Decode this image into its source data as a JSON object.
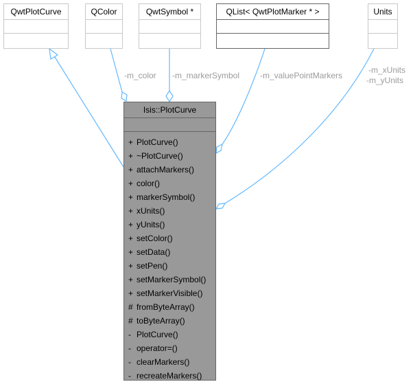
{
  "diagram": {
    "main_class": {
      "name": "Isis::PlotCurve",
      "methods": [
        {
          "vis": "+",
          "name": "PlotCurve()"
        },
        {
          "vis": "+",
          "name": "~PlotCurve()"
        },
        {
          "vis": "+",
          "name": "attachMarkers()"
        },
        {
          "vis": "+",
          "name": "color()"
        },
        {
          "vis": "+",
          "name": "markerSymbol()"
        },
        {
          "vis": "+",
          "name": "xUnits()"
        },
        {
          "vis": "+",
          "name": "yUnits()"
        },
        {
          "vis": "+",
          "name": "setColor()"
        },
        {
          "vis": "+",
          "name": "setData()"
        },
        {
          "vis": "+",
          "name": "setPen()"
        },
        {
          "vis": "+",
          "name": "setMarkerSymbol()"
        },
        {
          "vis": "+",
          "name": "setMarkerVisible()"
        },
        {
          "vis": "#",
          "name": "fromByteArray()"
        },
        {
          "vis": "#",
          "name": "toByteArray()"
        },
        {
          "vis": "-",
          "name": "PlotCurve()"
        },
        {
          "vis": "-",
          "name": "operator=()"
        },
        {
          "vis": "-",
          "name": "clearMarkers()"
        },
        {
          "vis": "-",
          "name": "recreateMarkers()"
        }
      ]
    },
    "related_classes": [
      {
        "id": "qwtplotcurve",
        "name": "QwtPlotCurve",
        "relation": "inheritance"
      },
      {
        "id": "qcolor",
        "name": "QColor",
        "relation": "aggregation",
        "label": "-m_color"
      },
      {
        "id": "qwtsymbol",
        "name": "QwtSymbol *",
        "relation": "aggregation",
        "label": "-m_markerSymbol"
      },
      {
        "id": "qlist",
        "name": "QList< QwtPlotMarker * >",
        "relation": "aggregation",
        "label": "-m_valuePointMarkers"
      },
      {
        "id": "units",
        "name": "Units",
        "relation": "aggregation",
        "label": "-m_xUnits\n-m_yUnits",
        "label_lines": [
          "-m_xUnits",
          "-m_yUnits"
        ]
      }
    ],
    "colors": {
      "edge": "#63b8ff",
      "main_fill": "#999999",
      "label_text": "#9a9a9a"
    }
  }
}
